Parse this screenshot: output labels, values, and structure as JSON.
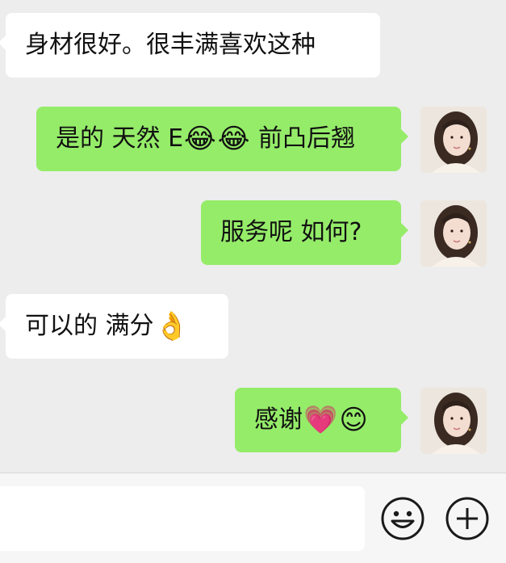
{
  "messages": [
    {
      "side": "in",
      "parts": [
        {
          "type": "text",
          "value": "身材很好。很丰满喜欢这种"
        }
      ]
    },
    {
      "side": "out",
      "parts": [
        {
          "type": "text",
          "value": "是的 天然 E"
        },
        {
          "type": "emoji",
          "value": "😂",
          "name": "tears-of-joy-emoji"
        },
        {
          "type": "emoji",
          "value": "😂",
          "name": "tears-of-joy-emoji"
        },
        {
          "type": "text",
          "value": " 前凸后翘"
        }
      ]
    },
    {
      "side": "out",
      "parts": [
        {
          "type": "text",
          "value": "服务呢 如何?"
        }
      ]
    },
    {
      "side": "in",
      "parts": [
        {
          "type": "text",
          "value": "可以的 满分"
        },
        {
          "type": "emoji",
          "value": "👌",
          "name": "ok-hand-emoji"
        }
      ]
    },
    {
      "side": "out",
      "parts": [
        {
          "type": "text",
          "value": "感谢"
        },
        {
          "type": "emoji",
          "value": "💗",
          "name": "pink-heart-emoji"
        },
        {
          "type": "emoji",
          "value": "😊",
          "name": "smiling-face-emoji"
        }
      ]
    }
  ],
  "input": {
    "value": "",
    "placeholder": ""
  },
  "icons": {
    "emoji_button": "smiley-face-icon",
    "more_button": "plus-circle-icon"
  },
  "colors": {
    "background": "#ededed",
    "incoming_bubble": "#ffffff",
    "outgoing_bubble": "#95ec69",
    "input_bar": "#f6f6f6"
  }
}
